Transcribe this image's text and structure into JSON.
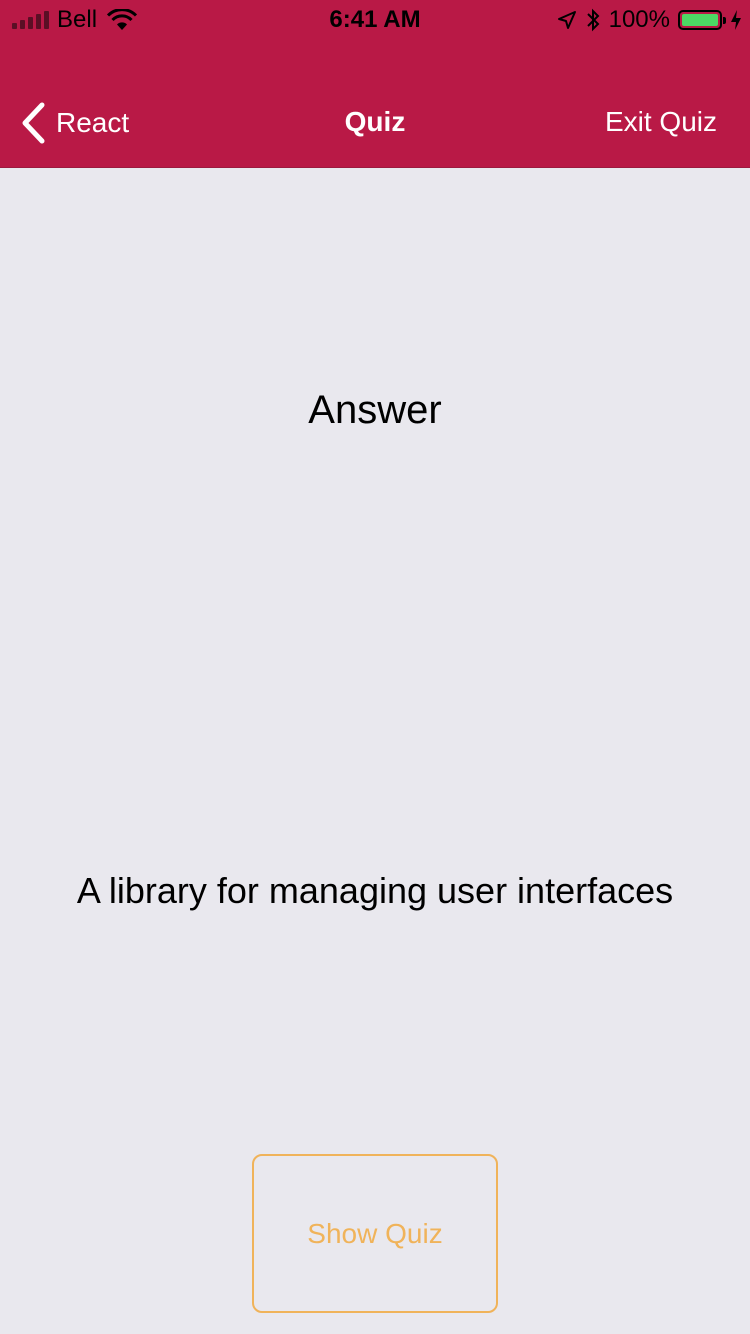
{
  "status_bar": {
    "carrier": "Bell",
    "time": "6:41 AM",
    "battery_percent": "100%",
    "icons": [
      "signal-icon",
      "wifi-icon",
      "location-arrow-icon",
      "bluetooth-icon",
      "battery-icon",
      "charging-bolt-icon"
    ]
  },
  "nav": {
    "back_label": "React",
    "title": "Quiz",
    "exit_label": "Exit Quiz"
  },
  "card": {
    "heading": "Answer",
    "answer": "A library for managing user interfaces"
  },
  "actions": {
    "show_quiz_label": "Show Quiz"
  },
  "colors": {
    "header_bg": "#b91946",
    "page_bg": "#e9e8ee",
    "accent": "#f0b35a",
    "battery_fill": "#4cd964"
  }
}
